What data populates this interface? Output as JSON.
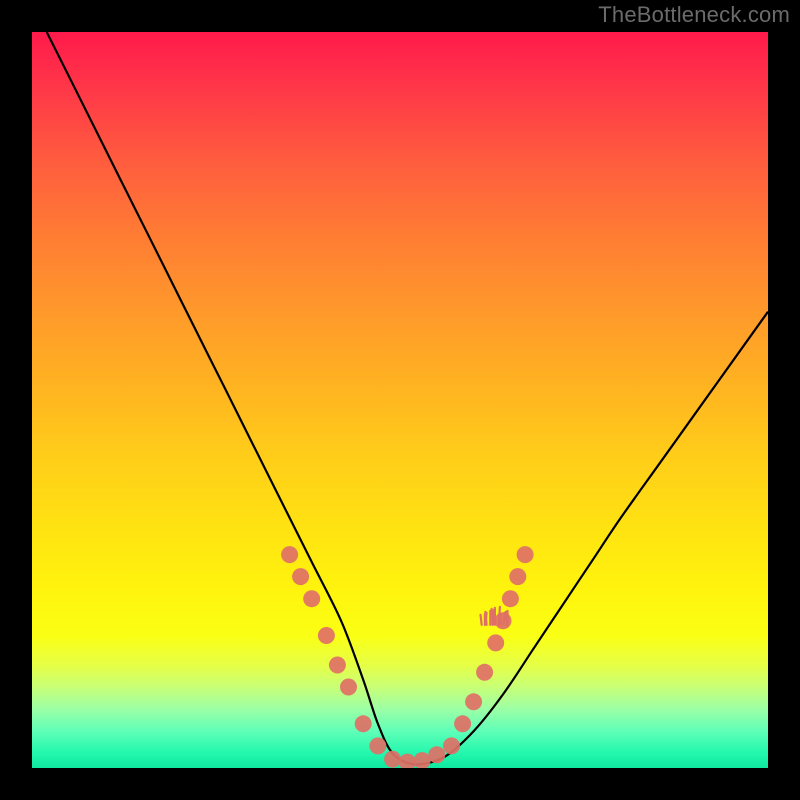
{
  "watermark": "TheBottleneck.com",
  "chart_data": {
    "type": "line",
    "title": "",
    "xlabel": "",
    "ylabel": "",
    "xlim": [
      0,
      100
    ],
    "ylim": [
      0,
      100
    ],
    "series": [
      {
        "name": "bottleneck-curve",
        "x": [
          2,
          6,
          10,
          14,
          18,
          22,
          26,
          30,
          34,
          38,
          42,
          45,
          47,
          49,
          52,
          56,
          60,
          64,
          68,
          72,
          76,
          80,
          85,
          90,
          95,
          100
        ],
        "y": [
          100,
          92,
          84,
          76,
          68,
          60,
          52,
          44,
          36,
          28,
          20,
          12,
          6,
          2,
          0.5,
          1.5,
          5,
          10,
          16,
          22,
          28,
          34,
          41,
          48,
          55,
          62
        ]
      }
    ],
    "markers": {
      "name": "dots",
      "color": "#e07066",
      "points": [
        {
          "x": 35,
          "y": 29
        },
        {
          "x": 36.5,
          "y": 26
        },
        {
          "x": 38,
          "y": 23
        },
        {
          "x": 40,
          "y": 18
        },
        {
          "x": 41.5,
          "y": 14
        },
        {
          "x": 43,
          "y": 11
        },
        {
          "x": 45,
          "y": 6
        },
        {
          "x": 47,
          "y": 3
        },
        {
          "x": 49,
          "y": 1.2
        },
        {
          "x": 51,
          "y": 0.8
        },
        {
          "x": 53,
          "y": 1.0
        },
        {
          "x": 55,
          "y": 1.8
        },
        {
          "x": 57,
          "y": 3
        },
        {
          "x": 58.5,
          "y": 6
        },
        {
          "x": 60,
          "y": 9
        },
        {
          "x": 61.5,
          "y": 13
        },
        {
          "x": 63,
          "y": 17
        },
        {
          "x": 64,
          "y": 20
        },
        {
          "x": 65,
          "y": 23
        },
        {
          "x": 66,
          "y": 26
        },
        {
          "x": 67,
          "y": 29
        }
      ]
    }
  }
}
